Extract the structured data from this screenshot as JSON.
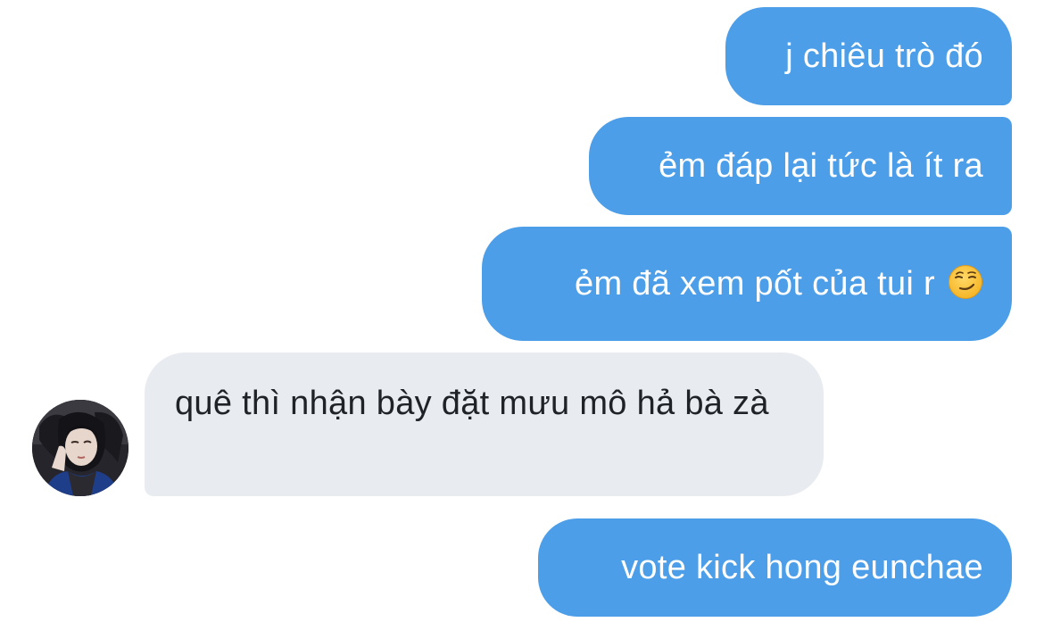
{
  "conversation": {
    "messages": [
      {
        "sender": "me",
        "text": "j chiêu trò đó"
      },
      {
        "sender": "me",
        "text": "ẻm đáp lại tức là ít ra"
      },
      {
        "sender": "me",
        "text": "ẻm đã xem pốt của tui r",
        "emoji_icon": "smirking-face-icon"
      },
      {
        "sender": "other",
        "text": "quê thì nhận bày đặt mưu mô hả bà zà",
        "avatar_icon": "contact-avatar"
      },
      {
        "sender": "me",
        "text": "vote kick hong eunchae"
      }
    ]
  },
  "colors": {
    "sent_bubble": "#4c9ee8",
    "received_bubble": "#e8ebef",
    "sent_text": "#ffffff",
    "received_text": "#1f2328",
    "background": "#ffffff"
  }
}
